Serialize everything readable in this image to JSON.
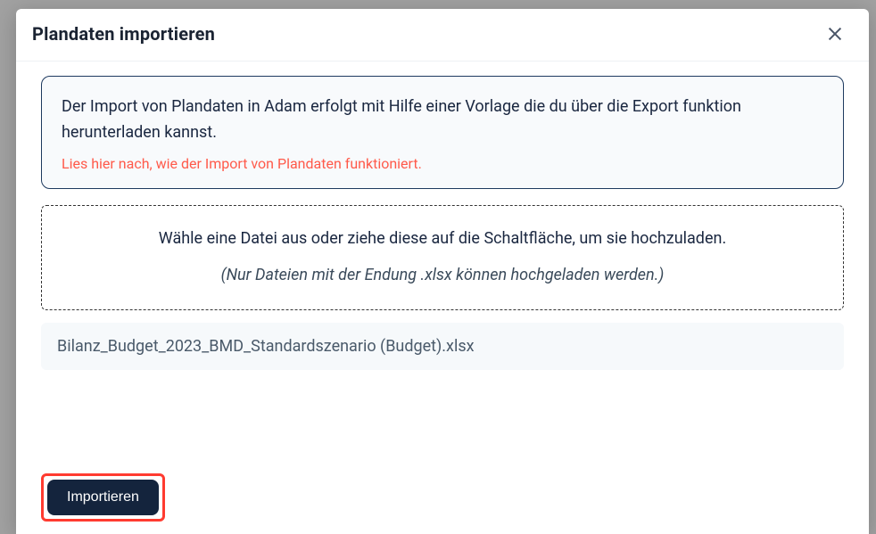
{
  "modal": {
    "title": "Plandaten importieren",
    "info": {
      "text": "Der Import von Plandaten in Adam erfolgt mit Hilfe einer Vorlage die du über die Export funktion herunterladen kannst.",
      "link": "Lies hier nach, wie der Import von Plandaten funktioniert."
    },
    "dropzone": {
      "main": "Wähle eine Datei aus oder ziehe diese auf die Schaltfläche, um sie hochzuladen.",
      "hint": "(Nur Dateien mit der Endung .xlsx können hochgeladen werden.)"
    },
    "selected_file": "Bilanz_Budget_2023_BMD_Standardszenario (Budget).xlsx",
    "footer": {
      "import_label": "Importieren"
    }
  }
}
